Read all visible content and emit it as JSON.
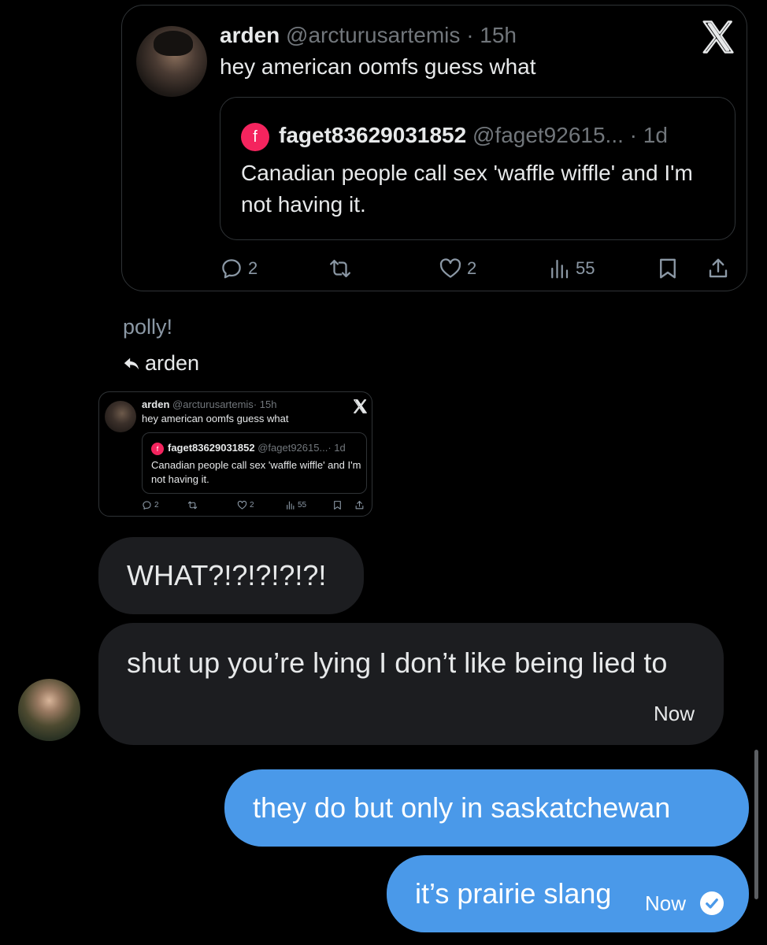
{
  "shared_tweet": {
    "author_name": "arden",
    "author_handle": "@arcturusartemis",
    "time": "· 15h",
    "text": "hey american oomfs guess what",
    "quoted": {
      "avatar_letter": "f",
      "author_name": "faget83629031852",
      "author_handle": "@faget92615...",
      "time": "· 1d",
      "text": "Canadian people call sex 'waffle wiffle' and I'm not having it."
    },
    "actions": {
      "replies": "2",
      "likes": "2",
      "views": "55"
    }
  },
  "sender_label": "polly!",
  "reply_to_label": "arden",
  "preview_tweet": {
    "author_name": "arden",
    "author_handle": "@arcturusartemis",
    "time": "· 15h",
    "text": "hey american oomfs guess what",
    "quoted": {
      "avatar_letter": "f",
      "author_name": "faget83629031852",
      "author_handle": "@faget92615...",
      "time": "· 1d",
      "text": "Canadian people call sex 'waffle wiffle' and I'm not having it."
    },
    "actions": {
      "replies": "2",
      "likes": "2",
      "views": "55"
    }
  },
  "messages": [
    {
      "direction": "incoming",
      "text": "WHAT?!?!?!?!?!"
    },
    {
      "direction": "incoming",
      "text": "shut up you’re lying I don’t like being lied to",
      "time": "Now"
    },
    {
      "direction": "outgoing",
      "text": "they do but only in saskatchewan"
    },
    {
      "direction": "outgoing",
      "text": "it’s prairie slang",
      "time": "Now",
      "status": "read"
    }
  ],
  "colors": {
    "background": "#000000",
    "incoming_bubble": "#1c1d20",
    "outgoing_bubble": "#4a99e9",
    "border": "#2f3336",
    "muted_text": "#71767b",
    "quoted_avatar": "#f4245e"
  }
}
